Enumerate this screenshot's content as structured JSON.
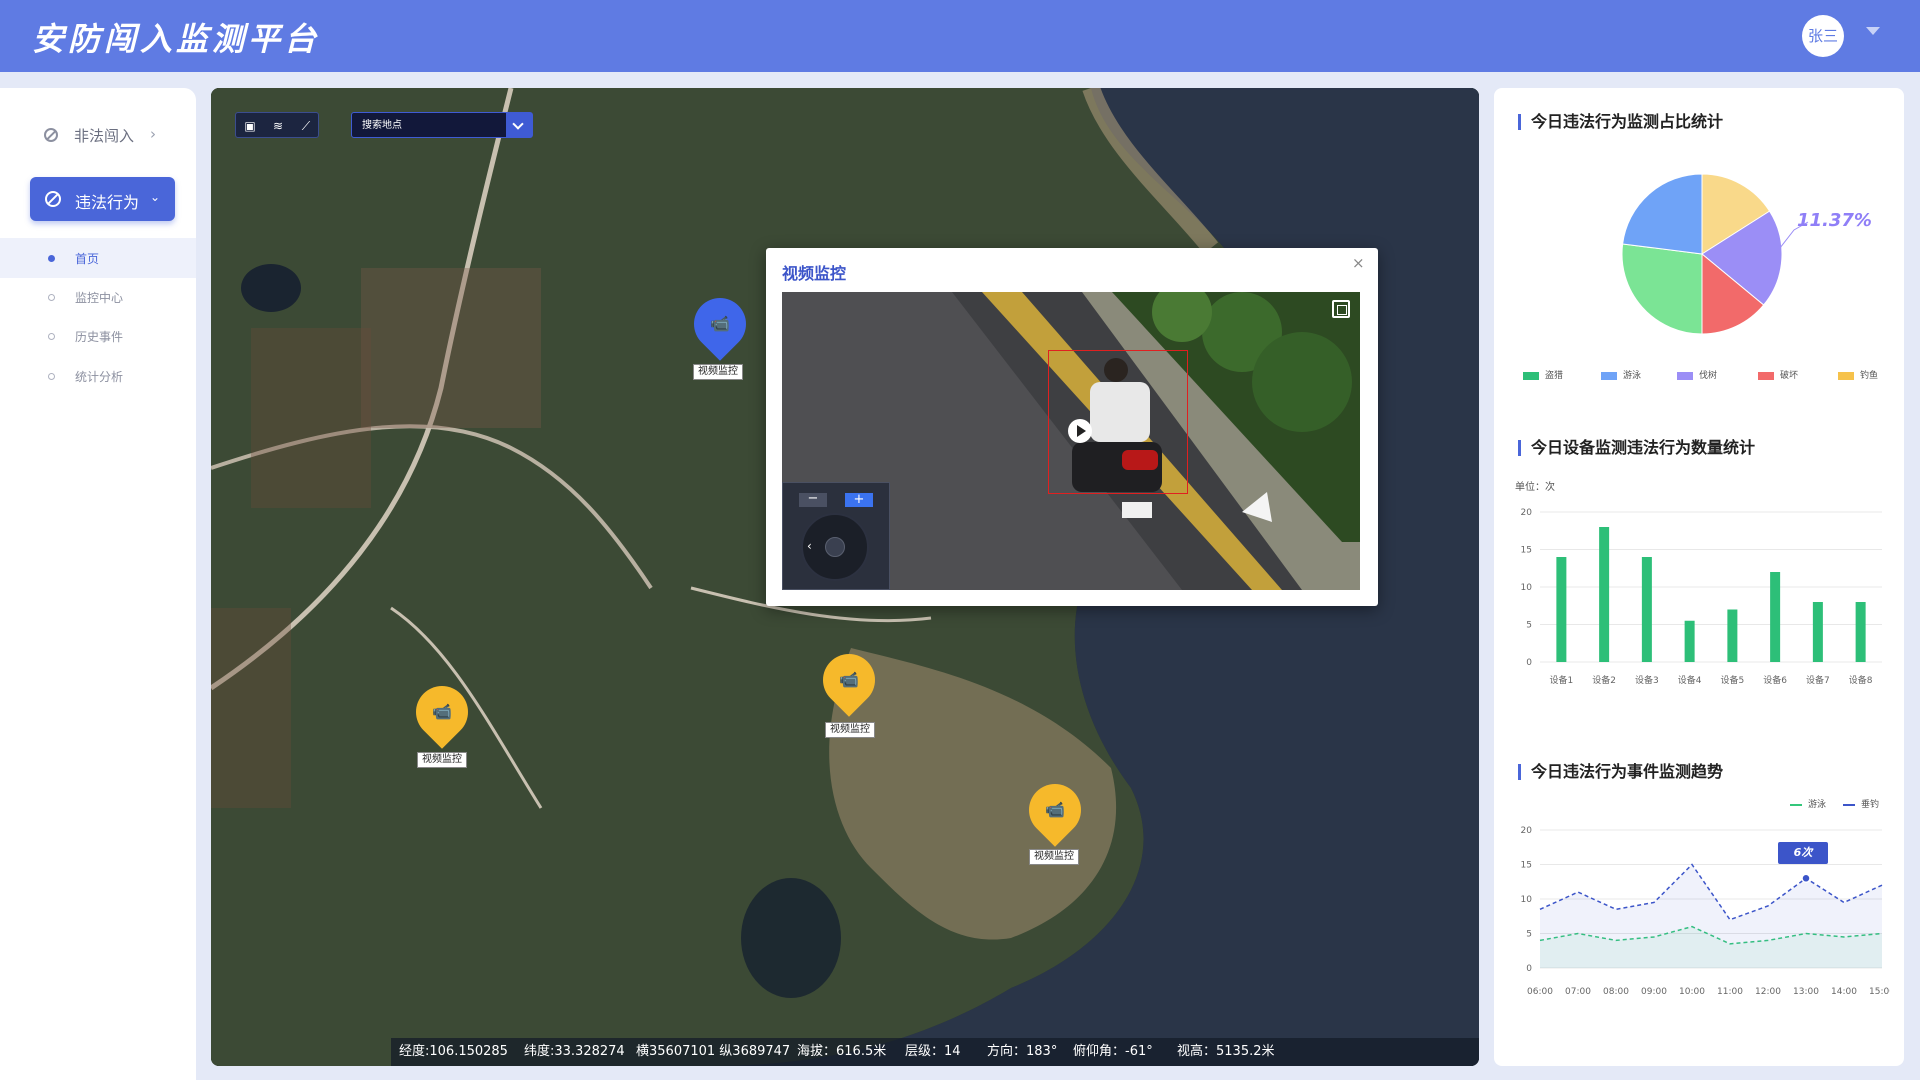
{
  "header": {
    "title": "安防闯入监测平台",
    "user": "张三"
  },
  "sidebar": {
    "top_item": "非法闯入",
    "active_item": "违法行为",
    "sub_items": [
      {
        "label": "首页"
      },
      {
        "label": "监控中心"
      },
      {
        "label": "历史事件"
      },
      {
        "label": "统计分析"
      }
    ]
  },
  "map": {
    "search_placeholder": "搜索地点",
    "markers": [
      {
        "label": "视频监控",
        "color": "blue"
      },
      {
        "label": "视频监控",
        "color": "yellow"
      },
      {
        "label": "视频监控",
        "color": "yellow"
      },
      {
        "label": "视频监控",
        "color": "yellow"
      }
    ],
    "status": {
      "lng": "经度:106.150285",
      "lat": "纬度:33.328274",
      "xy": "横35607101 纵3689747",
      "alt": "海拔：616.5米",
      "level": "层级：14",
      "dir": "方向：183°",
      "pitch": "俯仰角：-61°",
      "height": "视高：5135.2米"
    }
  },
  "popup": {
    "title": "视频监控",
    "close": "×",
    "zoom_out": "−",
    "zoom_in": "+"
  },
  "chart_data": [
    {
      "type": "pie",
      "title": "今日违法行为监测占比统计",
      "categories": [
        "盗猎",
        "游泳",
        "伐树",
        "破坏",
        "钓鱼"
      ],
      "values": [
        27,
        23,
        20,
        14,
        16
      ],
      "colors": [
        "#7be495",
        "#6fa3f7",
        "#9b8ef6",
        "#f26a6a",
        "#f9d98a"
      ],
      "annotation": "11.37%"
    },
    {
      "type": "bar",
      "title": "今日设备监测违法行为数量统计",
      "ylabel": "单位：次",
      "categories": [
        "设备1",
        "设备2",
        "设备3",
        "设备4",
        "设备5",
        "设备6",
        "设备7",
        "设备8"
      ],
      "values": [
        14,
        18,
        14,
        5.5,
        7,
        12,
        8,
        8
      ],
      "ylim": [
        0,
        20
      ],
      "yticks": [
        0,
        5,
        10,
        15,
        20
      ],
      "color": "#2dbf78"
    },
    {
      "type": "line",
      "title": "今日违法行为事件监测趋势",
      "x": [
        "06:00",
        "07:00",
        "08:00",
        "09:00",
        "10:00",
        "11:00",
        "12:00",
        "13:00",
        "14:00",
        "15:00"
      ],
      "series": [
        {
          "name": "游泳",
          "values": [
            4,
            5,
            4,
            4.5,
            6,
            3.5,
            4,
            5,
            4.5,
            5
          ],
          "color": "#34c77b"
        },
        {
          "name": "垂钓",
          "values": [
            8.5,
            11,
            8.5,
            9.5,
            15,
            7,
            9,
            13,
            9.5,
            12
          ],
          "color": "#3c55c9"
        }
      ],
      "ylim": [
        0,
        20
      ],
      "yticks": [
        0,
        5,
        10,
        15,
        20
      ],
      "tooltip": "6次"
    }
  ]
}
